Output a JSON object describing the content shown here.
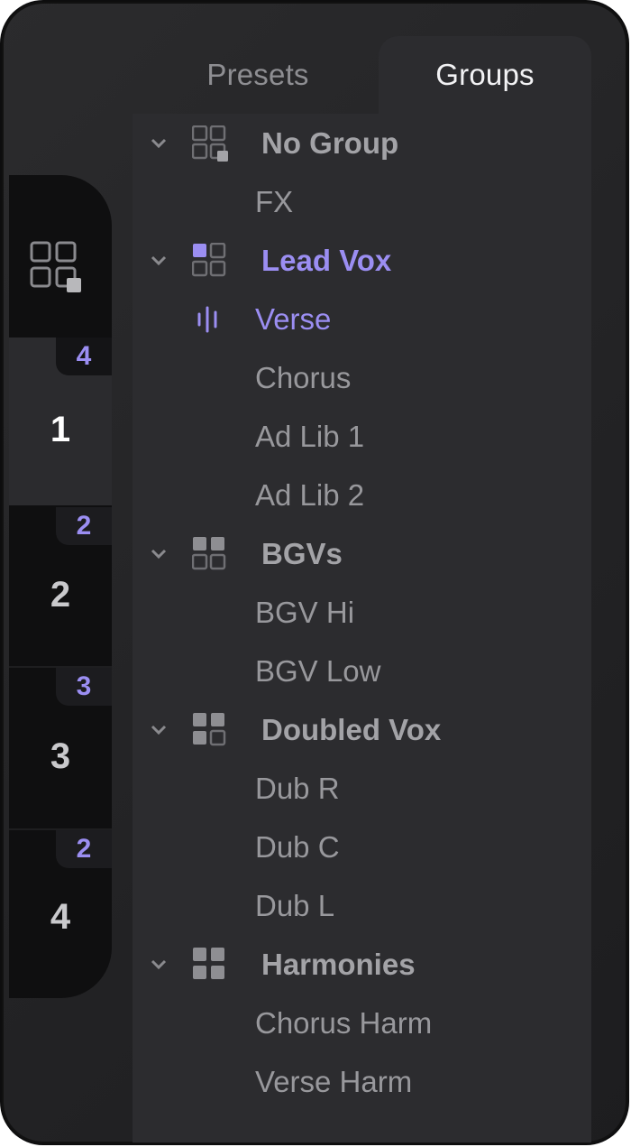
{
  "tabs": {
    "presets": "Presets",
    "groups": "Groups",
    "active": "groups"
  },
  "rail": {
    "slots": [
      {
        "label": "1",
        "badge": "4",
        "active": true
      },
      {
        "label": "2",
        "badge": "2",
        "active": false
      },
      {
        "label": "3",
        "badge": "3",
        "active": false
      },
      {
        "label": "4",
        "badge": "2",
        "active": false
      }
    ]
  },
  "groups": [
    {
      "name": "No Group",
      "icon": "grid-empty-icon",
      "active": false,
      "items": [
        "FX"
      ]
    },
    {
      "name": "Lead Vox",
      "icon": "grid-one-filled-icon",
      "active": true,
      "items": [
        "Verse",
        "Chorus",
        "Ad Lib 1",
        "Ad Lib 2"
      ],
      "active_item": "Verse"
    },
    {
      "name": "BGVs",
      "icon": "grid-two-filled-icon",
      "active": false,
      "items": [
        "BGV Hi",
        "BGV Low"
      ]
    },
    {
      "name": "Doubled Vox",
      "icon": "grid-three-filled-icon",
      "active": false,
      "items": [
        "Dub R",
        "Dub C",
        "Dub L"
      ]
    },
    {
      "name": "Harmonies",
      "icon": "grid-four-filled-icon",
      "active": false,
      "items": [
        "Chorus Harm",
        "Verse Harm"
      ]
    }
  ],
  "colors": {
    "accent": "#9b8ef2",
    "background": "#2c2c2f",
    "rail": "#0f0f10"
  }
}
